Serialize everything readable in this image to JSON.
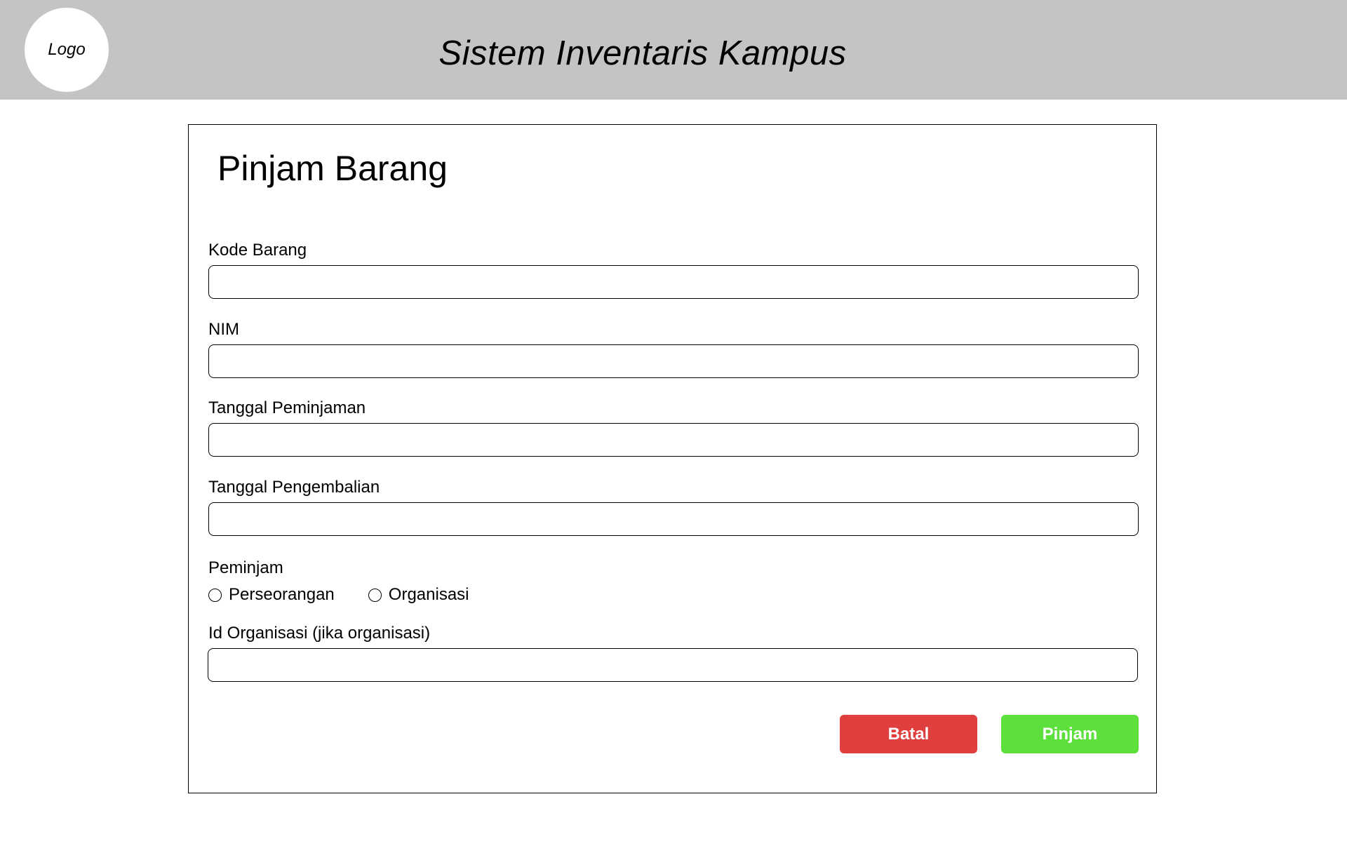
{
  "header": {
    "logo_text": "Logo",
    "title": "Sistem Inventaris Kampus"
  },
  "form": {
    "title": "Pinjam Barang",
    "fields": [
      {
        "label": "Kode Barang",
        "value": "",
        "placeholder": ""
      },
      {
        "label": "NIM",
        "value": "",
        "placeholder": ""
      },
      {
        "label": "Tanggal Peminjaman",
        "value": "",
        "placeholder": ""
      },
      {
        "label": "Tanggal Pengembalian",
        "value": "",
        "placeholder": ""
      }
    ],
    "borrower": {
      "label": "Peminjam",
      "options": [
        "Perseorangan",
        "Organisasi"
      ],
      "selected": ""
    },
    "org_id": {
      "label": "Id Organisasi (jika organisasi)",
      "value": "",
      "placeholder": ""
    },
    "buttons": {
      "cancel_label": "Batal",
      "submit_label": "Pinjam"
    }
  },
  "colors": {
    "header_bg": "#c4c4c4",
    "cancel_button": "#df3f3f",
    "submit_button": "#5ee03c"
  }
}
